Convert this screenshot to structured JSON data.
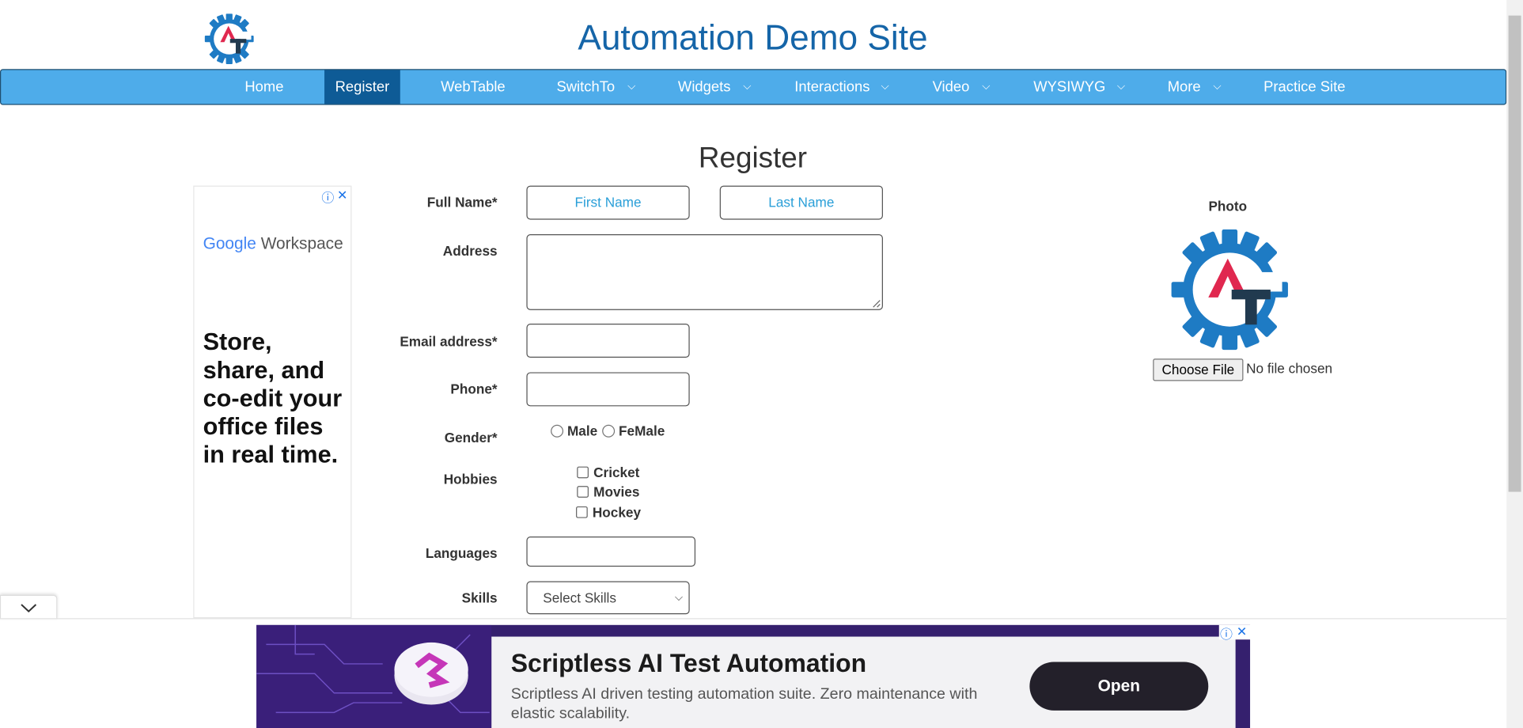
{
  "header": {
    "title": "Automation Demo Site",
    "logo_icon": "automation-testing-gear-logo",
    "logo_text": "AT"
  },
  "nav": {
    "items": [
      {
        "label": "Home",
        "dropdown": false
      },
      {
        "label": "Register",
        "dropdown": false,
        "active": true
      },
      {
        "label": "WebTable",
        "dropdown": false
      },
      {
        "label": "SwitchTo",
        "dropdown": true
      },
      {
        "label": "Widgets",
        "dropdown": true
      },
      {
        "label": "Interactions",
        "dropdown": true
      },
      {
        "label": "Video",
        "dropdown": true
      },
      {
        "label": "WYSIWYG",
        "dropdown": true
      },
      {
        "label": "More",
        "dropdown": true
      },
      {
        "label": "Practice Site",
        "dropdown": false
      }
    ],
    "chevron": "⌄"
  },
  "form": {
    "heading": "Register",
    "full_name_label": "Full Name*",
    "first_name_placeholder": "First Name",
    "last_name_placeholder": "Last Name",
    "address_label": "Address",
    "email_label": "Email address*",
    "phone_label": "Phone*",
    "gender_label": "Gender*",
    "gender_options": [
      "Male",
      "FeMale"
    ],
    "hobbies_label": "Hobbies",
    "hobbies": [
      "Cricket",
      "Movies",
      "Hockey"
    ],
    "languages_label": "Languages",
    "skills_label": "Skills",
    "skills_selected": "Select Skills"
  },
  "photo": {
    "label": "Photo",
    "choose_button": "Choose File",
    "status": "No file chosen"
  },
  "left_ad": {
    "brand_google": "Google",
    "brand_product": "Workspace",
    "text": "Store, share, and co-edit your office files in real time.",
    "info_icon": "ⓘ",
    "close_icon": "✕"
  },
  "bottom_ad": {
    "title": "Scriptless AI Test Automation",
    "description": "Scriptless AI driven testing automation suite. Zero maintenance with elastic scalability.",
    "button": "Open",
    "info_icon": "ⓘ",
    "close_icon": "✕"
  },
  "colors": {
    "nav_bg": "#4eacea",
    "nav_active": "#0e5b96",
    "title": "#1565a8",
    "logo_blue": "#1e7bc4",
    "logo_red": "#e0284f",
    "logo_dark": "#213a4f"
  }
}
